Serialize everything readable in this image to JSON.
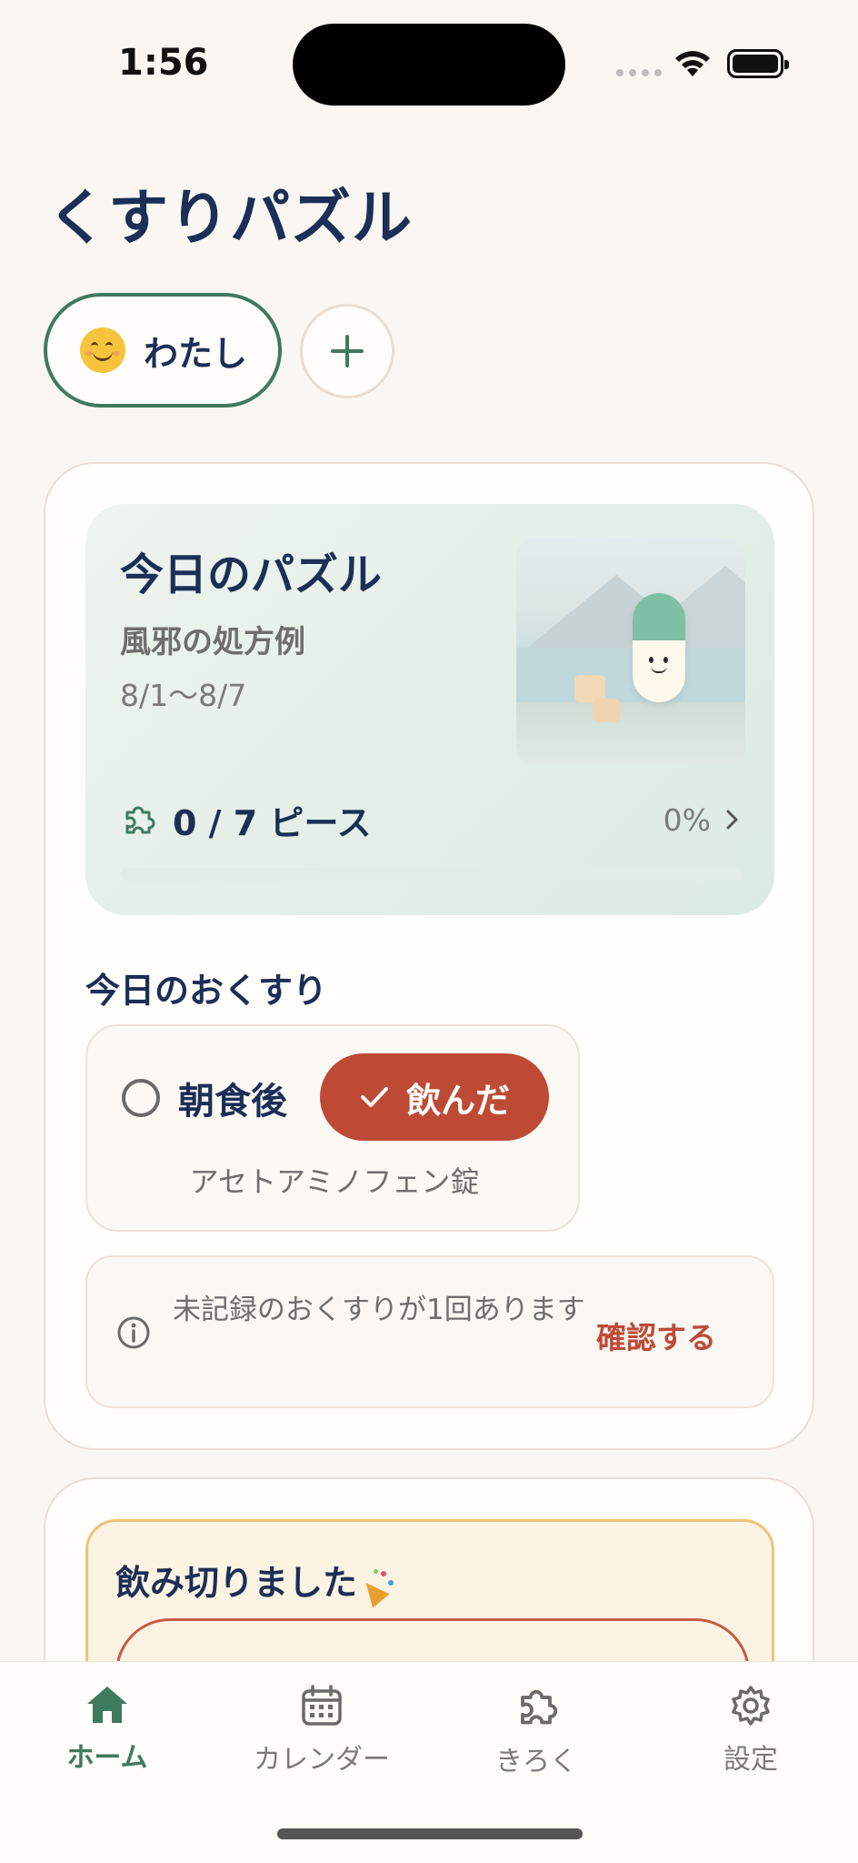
{
  "status_bar": {
    "time": "1:56"
  },
  "app": {
    "title": "くすりパズル"
  },
  "profiles": {
    "active_name": "わたし",
    "active_emoji_icon": "smiling-face-icon",
    "add_icon": "plus-icon"
  },
  "puzzle": {
    "title": "今日のパズル",
    "prescription": "風邪の処方例",
    "dates": "8/1〜8/7",
    "pieces_text": "0 / 7 ピース",
    "percent_text": "0%",
    "progress_fraction": 0
  },
  "today": {
    "section_title": "今日のおくすり",
    "dose": {
      "time_label": "朝食後",
      "took_button": "飲んだ",
      "medicine": "アセトアミノフェン錠"
    }
  },
  "notice": {
    "text": "未記録のおくすりが1回あります",
    "action": "確認する"
  },
  "finished": {
    "title": "飲み切りました"
  },
  "tabs": [
    {
      "label": "ホーム",
      "icon": "house-icon",
      "active": true
    },
    {
      "label": "カレンダー",
      "icon": "calendar-icon",
      "active": false
    },
    {
      "label": "きろく",
      "icon": "puzzle-piece-icon",
      "active": false
    },
    {
      "label": "設定",
      "icon": "gear-icon",
      "active": false
    }
  ],
  "colors": {
    "accent_green": "#3E7A5E",
    "accent_red": "#BE4A36",
    "navy_text": "#1B2F57",
    "background": "#FAF7F2"
  }
}
